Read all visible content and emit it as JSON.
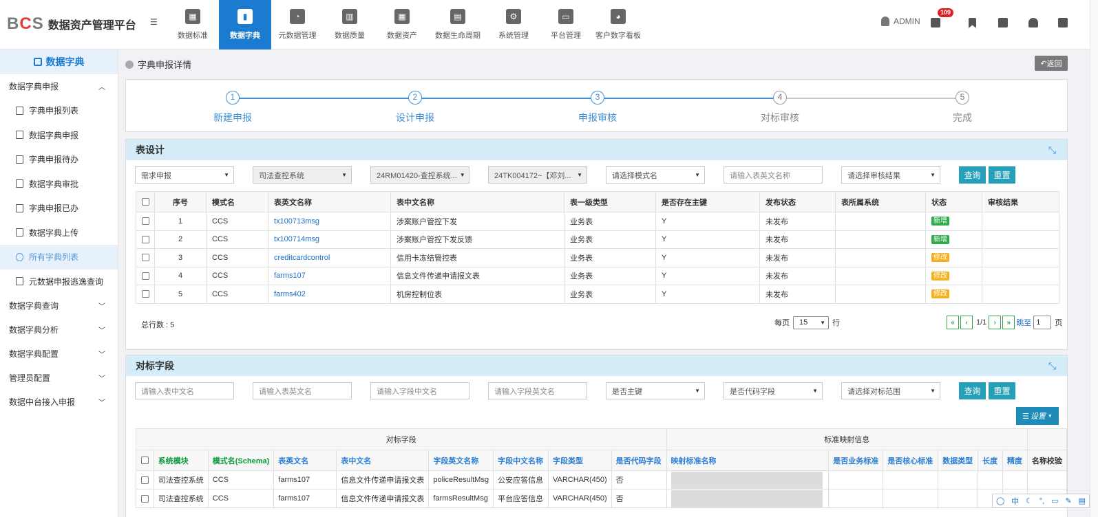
{
  "header": {
    "logo_text": "BCS",
    "app_title": "数据资产管理平台",
    "nav": [
      {
        "label": "数据标准",
        "icon": "table-icon"
      },
      {
        "label": "数据字典",
        "icon": "book-icon",
        "active": true
      },
      {
        "label": "元数据管理",
        "icon": "pie-chart-icon"
      },
      {
        "label": "数据质量",
        "icon": "bar-chart-icon"
      },
      {
        "label": "数据资产",
        "icon": "grid-icon"
      },
      {
        "label": "数据生命周期",
        "icon": "clipboard-icon"
      },
      {
        "label": "系统管理",
        "icon": "gear-icon"
      },
      {
        "label": "平台管理",
        "icon": "monitor-icon"
      },
      {
        "label": "客户数字看板",
        "icon": "dashboard-icon"
      }
    ],
    "user": "ADMIN",
    "notification_count": "109"
  },
  "sidebar": {
    "title": "数据字典",
    "groups": [
      {
        "label": "数据字典申报",
        "expanded": true
      },
      {
        "label": "数据字典查询"
      },
      {
        "label": "数据字典分析"
      },
      {
        "label": "数据字典配置"
      },
      {
        "label": "管理员配置"
      },
      {
        "label": "数据中台接入申报"
      }
    ],
    "items": [
      {
        "label": "字典申报列表"
      },
      {
        "label": "数据字典申报"
      },
      {
        "label": "字典申报待办"
      },
      {
        "label": "数据字典审批"
      },
      {
        "label": "字典申报已办"
      },
      {
        "label": "数据字典上传"
      },
      {
        "label": "所有字典列表",
        "active": true
      },
      {
        "label": "元数据申报逃逸查询"
      }
    ]
  },
  "page": {
    "breadcrumb": "字典申报详情",
    "back_label": "返回"
  },
  "steps": [
    {
      "num": "1",
      "label": "新建申报",
      "done": true
    },
    {
      "num": "2",
      "label": "设计申报",
      "done": true
    },
    {
      "num": "3",
      "label": "申报审核",
      "done": true
    },
    {
      "num": "4",
      "label": "对标审核",
      "done": false
    },
    {
      "num": "5",
      "label": "完成",
      "done": false
    }
  ],
  "table_design": {
    "title": "表设计",
    "filters": {
      "demand": "需求申报",
      "system": "司法查控系统",
      "req": "24RM01420-查控系统...",
      "task": "24TK004172~【邓刘...",
      "schema_placeholder": "请选择模式名",
      "table_en_placeholder": "请输入表英文名称",
      "review_placeholder": "请选择审核结果"
    },
    "query_label": "查询",
    "reset_label": "重置",
    "columns": [
      "序号",
      "模式名",
      "表英文名称",
      "表中文名称",
      "表一级类型",
      "是否存在主键",
      "发布状态",
      "表所属系统",
      "状态",
      "审核结果"
    ],
    "rows": [
      {
        "no": "1",
        "schema": "CCS",
        "en": "tx100713msg",
        "cn": "涉案账户管控下发",
        "type": "业务表",
        "pk": "Y",
        "pub": "未发布",
        "sys": "",
        "status": "新增",
        "status_color": "#2eaa4a",
        "result": ""
      },
      {
        "no": "2",
        "schema": "CCS",
        "en": "tx100714msg",
        "cn": "涉案账户管控下发反馈",
        "type": "业务表",
        "pk": "Y",
        "pub": "未发布",
        "sys": "",
        "status": "新增",
        "status_color": "#2eaa4a",
        "result": ""
      },
      {
        "no": "3",
        "schema": "CCS",
        "en": "creditcardcontrol",
        "cn": "信用卡冻结管控表",
        "type": "业务表",
        "pk": "Y",
        "pub": "未发布",
        "sys": "",
        "status": "修改",
        "status_color": "#f5b020",
        "result": ""
      },
      {
        "no": "4",
        "schema": "CCS",
        "en": "farms107",
        "cn": "信息文件传递申请报文表",
        "type": "业务表",
        "pk": "Y",
        "pub": "未发布",
        "sys": "",
        "status": "修改",
        "status_color": "#f5b020",
        "result": ""
      },
      {
        "no": "5",
        "schema": "CCS",
        "en": "farms402",
        "cn": "机房控制位表",
        "type": "业务表",
        "pk": "Y",
        "pub": "未发布",
        "sys": "",
        "status": "修改",
        "status_color": "#f5b020",
        "result": ""
      }
    ],
    "total_label": "总行数 : 5",
    "per_page_label": "每页",
    "per_page_value": "15",
    "row_unit": "行",
    "page_info": "1/1",
    "jump_label": "跳至",
    "jump_value": "1",
    "page_unit": "页"
  },
  "benchmark": {
    "title": "对标字段",
    "filters": {
      "table_cn_placeholder": "请输入表中文名",
      "table_en_placeholder": "请输入表英文名",
      "field_cn_placeholder": "请输入字段中文名",
      "field_en_placeholder": "请输入字段英文名",
      "pk": "是否主键",
      "code": "是否代码字段",
      "range": "请选择对标范围"
    },
    "query_label": "查询",
    "reset_label": "重置",
    "settings_label": "设置",
    "group_left": "对标字段",
    "group_right": "标准映射信息",
    "columns": [
      "系统模块",
      "模式名(Schema)",
      "表英文名",
      "表中文名",
      "字段英文名称",
      "字段中文名称",
      "字段类型",
      "是否代码字段",
      "映射标准名称",
      "是否业务标准",
      "是否核心标准",
      "数据类型",
      "长度",
      "精度",
      "名称校验"
    ],
    "rows": [
      {
        "module": "司法查控系统",
        "schema": "CCS",
        "en": "farms107",
        "cn": "信息文件传递申请报文表",
        "fen": "policeResultMsg",
        "fcn": "公安应答信息",
        "ftype": "VARCHAR(450)",
        "code": "否"
      },
      {
        "module": "司法查控系统",
        "schema": "CCS",
        "en": "farms107",
        "cn": "信息文件传递申请报文表",
        "fen": "farmsResultMsg",
        "fcn": "平台应答信息",
        "ftype": "VARCHAR(450)",
        "code": "否"
      }
    ]
  },
  "ime": "中"
}
